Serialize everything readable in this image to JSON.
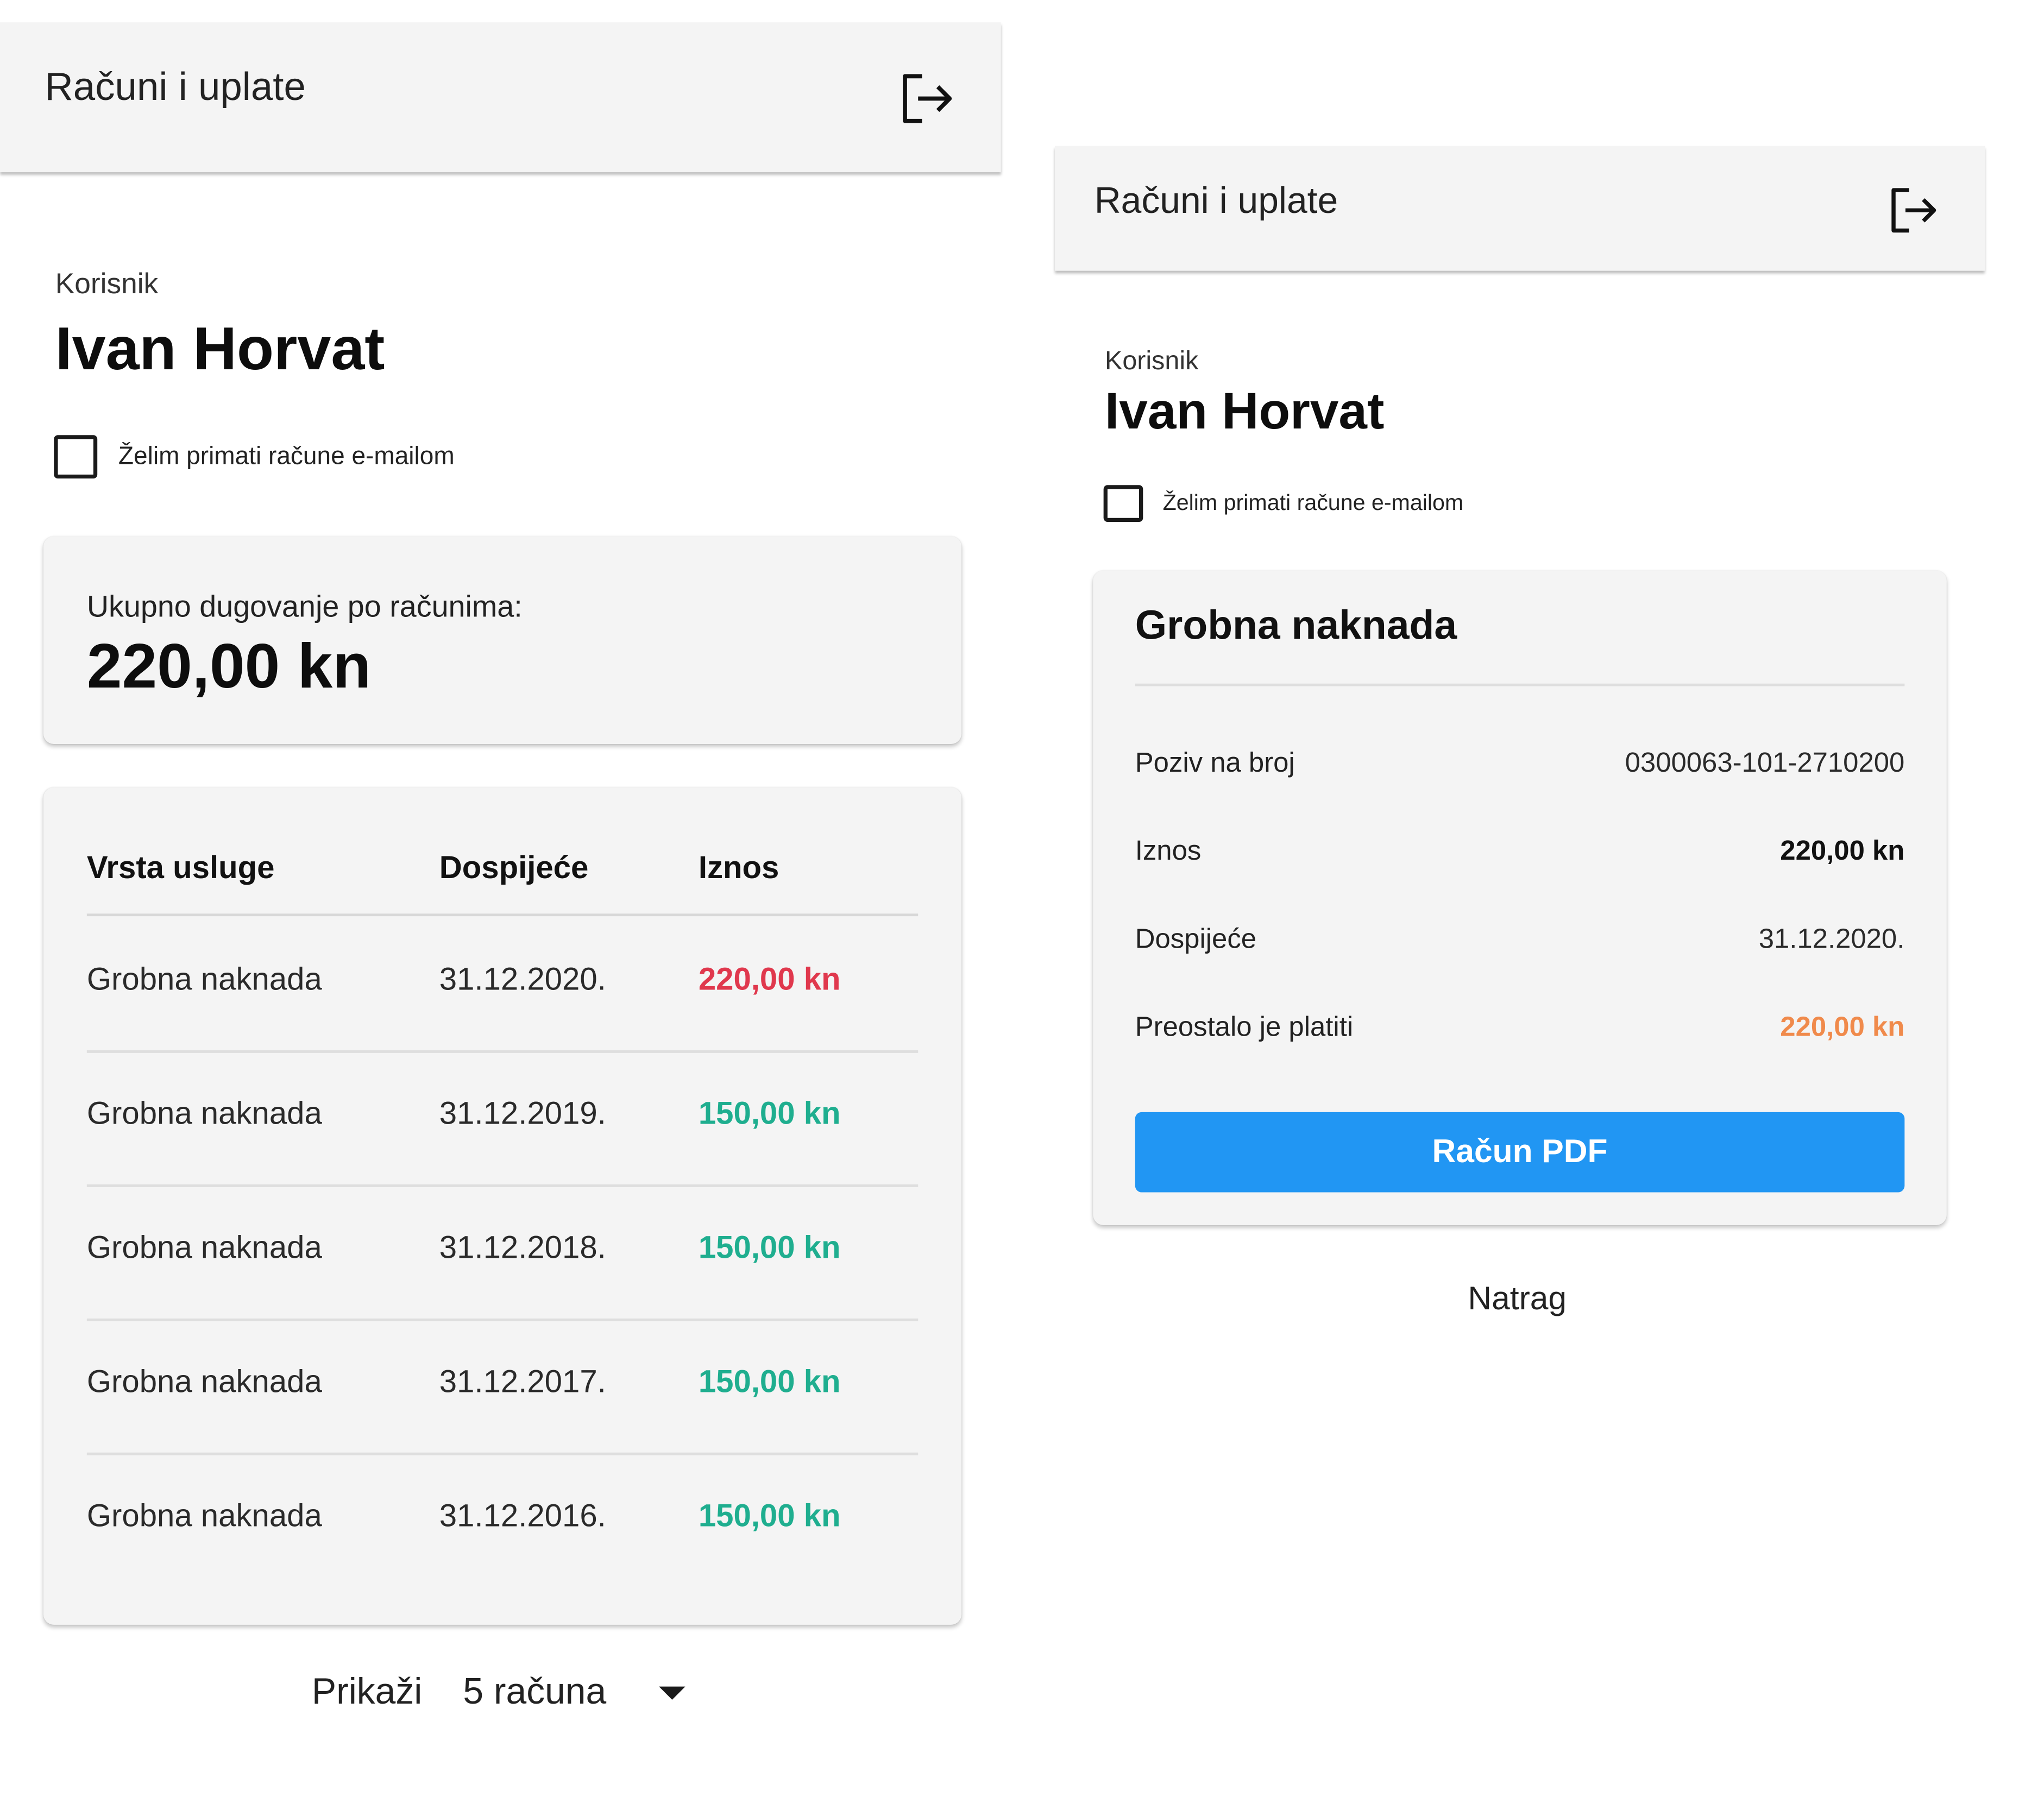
{
  "colors": {
    "overdue": "#e0384d",
    "paid": "#1fae8f",
    "remaining": "#f08a4b",
    "primary": "#2196f3"
  },
  "list_screen": {
    "header": {
      "title": "Računi i uplate",
      "logout_icon": "logout-icon"
    },
    "user": {
      "caption": "Korisnik",
      "name": "Ivan Horvat"
    },
    "email_opt_in": {
      "label": "Želim primati račune e-mailom",
      "checked": false
    },
    "debt": {
      "label": "Ukupno dugovanje po računima:",
      "amount": "220,00 kn"
    },
    "bills_table": {
      "columns": [
        "Vrsta usluge",
        "Dospijeće",
        "Iznos"
      ],
      "rows": [
        {
          "service": "Grobna naknada",
          "due": "31.12.2020.",
          "amount": "220,00 kn",
          "status": "overdue"
        },
        {
          "service": "Grobna naknada",
          "due": "31.12.2019.",
          "amount": "150,00 kn",
          "status": "paid"
        },
        {
          "service": "Grobna naknada",
          "due": "31.12.2018.",
          "amount": "150,00 kn",
          "status": "paid"
        },
        {
          "service": "Grobna naknada",
          "due": "31.12.2017.",
          "amount": "150,00 kn",
          "status": "paid"
        },
        {
          "service": "Grobna naknada",
          "due": "31.12.2016.",
          "amount": "150,00 kn",
          "status": "paid"
        }
      ]
    },
    "pagination": {
      "show_label": "Prikaži",
      "selected": "5 računa",
      "dropdown_icon": "caret-down-icon"
    }
  },
  "detail_screen": {
    "header": {
      "title": "Računi i uplate",
      "logout_icon": "logout-icon"
    },
    "user": {
      "caption": "Korisnik",
      "name": "Ivan Horvat"
    },
    "email_opt_in": {
      "label": "Želim primati račune e-mailom",
      "checked": false
    },
    "bill": {
      "title": "Grobna naknada",
      "fields": [
        {
          "label": "Poziv na broj",
          "value": "0300063-101-2710200",
          "style": "normal"
        },
        {
          "label": "Iznos",
          "value": "220,00 kn",
          "style": "bold"
        },
        {
          "label": "Dospijeće",
          "value": "31.12.2020.",
          "style": "normal"
        },
        {
          "label": "Preostalo je platiti",
          "value": "220,00 kn",
          "style": "remaining"
        }
      ],
      "pdf_button": "Račun PDF"
    },
    "back_link": "Natrag"
  }
}
